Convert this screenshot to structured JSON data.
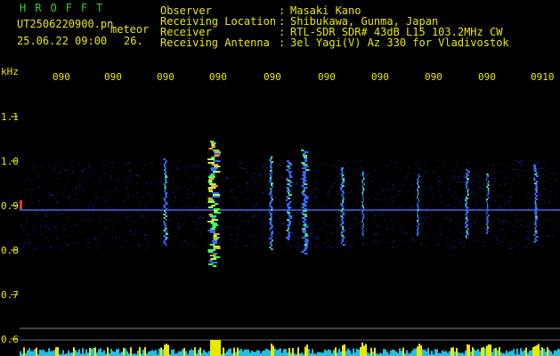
{
  "header": {
    "brand": "HROFFT",
    "filename": "UT2506220900.pn",
    "mode": "meteor",
    "datetime": "25.06.22 09:00",
    "count": "26.",
    "labels": [
      "Observer",
      "Receiving Location",
      "Receiver",
      "Receiving Antenna"
    ],
    "colons": [
      ":",
      ":",
      ":",
      ":"
    ],
    "values": [
      "Masaki Kano",
      "Shibukawa, Gunma, Japan",
      "RTL-SDR SDR# 43dB L15 103.2MHz CW",
      "3el Yagi(V) Az 330 for Vladivostok"
    ]
  },
  "axis": {
    "unit": "kHz",
    "time_ticks": [
      "090",
      "090",
      "090",
      "090",
      "090",
      "090",
      "090",
      "090",
      "090",
      "0910"
    ],
    "freq_ticks": [
      "1.1",
      "1.0",
      "0.9",
      "0.8",
      "0.7",
      "0.6"
    ]
  },
  "colors": {
    "text": "#e8e800",
    "brand": "#2fd12f",
    "background": "#000000",
    "signal_line": "#3060ff",
    "meteor_hot": "#30ff60"
  }
}
